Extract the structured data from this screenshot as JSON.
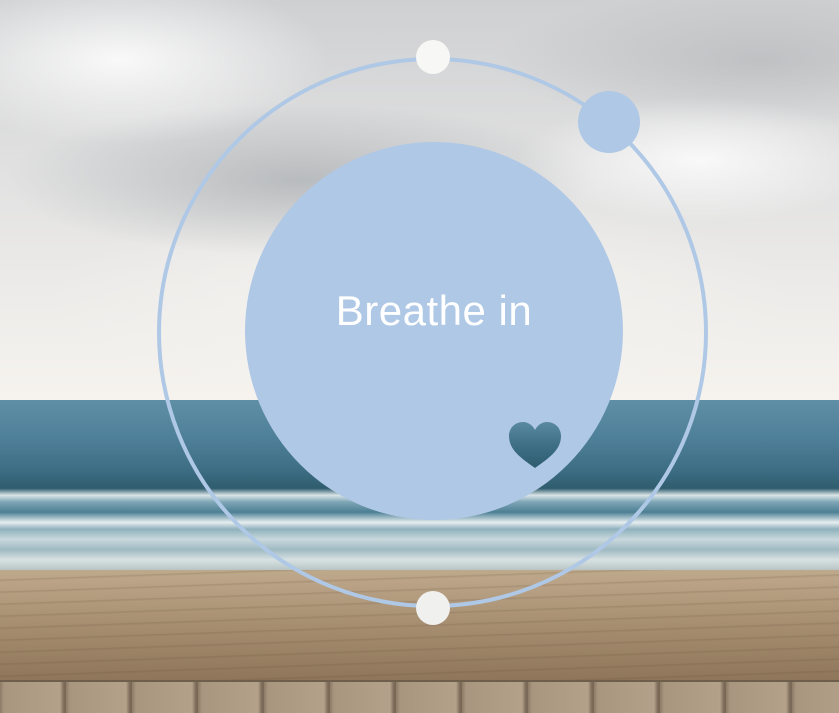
{
  "exercise": {
    "label": "Breathe in",
    "accent_color": "#afc8e6",
    "marker_color": "#f7f7f6",
    "background_scene": "beach-at-sunrise",
    "center_icon": "heart-icon"
  }
}
